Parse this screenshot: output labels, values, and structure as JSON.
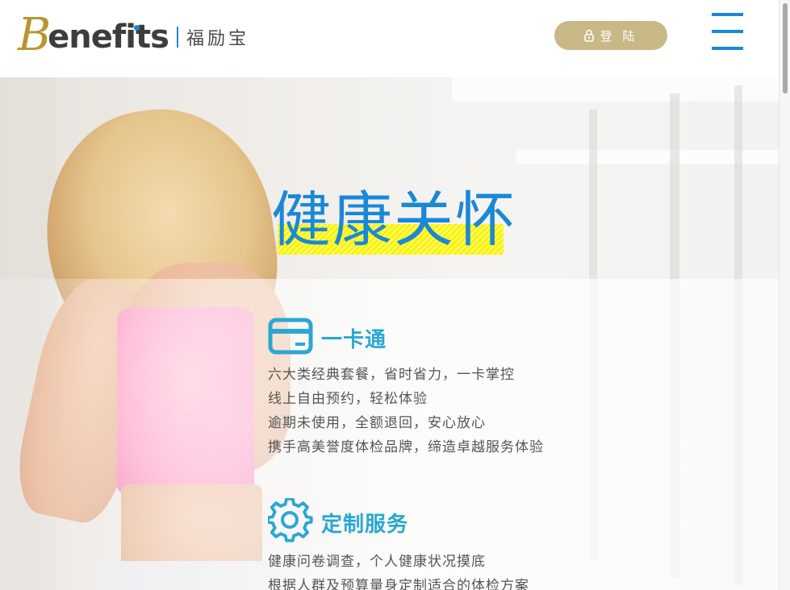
{
  "header": {
    "logo_letter": "B",
    "logo_word": "enefits",
    "logo_cn": "福励宝",
    "login_label": "登 陆",
    "login_icon": "lock-icon",
    "menu_icon": "hamburger-menu-icon"
  },
  "hero": {
    "title": "健康关怀",
    "features": [
      {
        "icon": "card-icon",
        "title": "一卡通",
        "lines": [
          "六大类经典套餐，省时省力，一卡掌控",
          "线上自由预约，轻松体验",
          "逾期未使用，全额退回，安心放心",
          "携手高美誉度体检品牌，缔造卓越服务体验"
        ]
      },
      {
        "icon": "gear-icon",
        "title": "定制服务",
        "lines": [
          "健康问卷调查，个人健康状况摸底",
          "根据人群及预算量身定制适合的体检方案"
        ]
      }
    ]
  },
  "colors": {
    "brand_blue": "#1b88d6",
    "brand_gold": "#b8952f",
    "login_bg": "#c8b886",
    "feature_cyan": "#2aa7d4",
    "highlight_yellow": "#f9f300"
  }
}
